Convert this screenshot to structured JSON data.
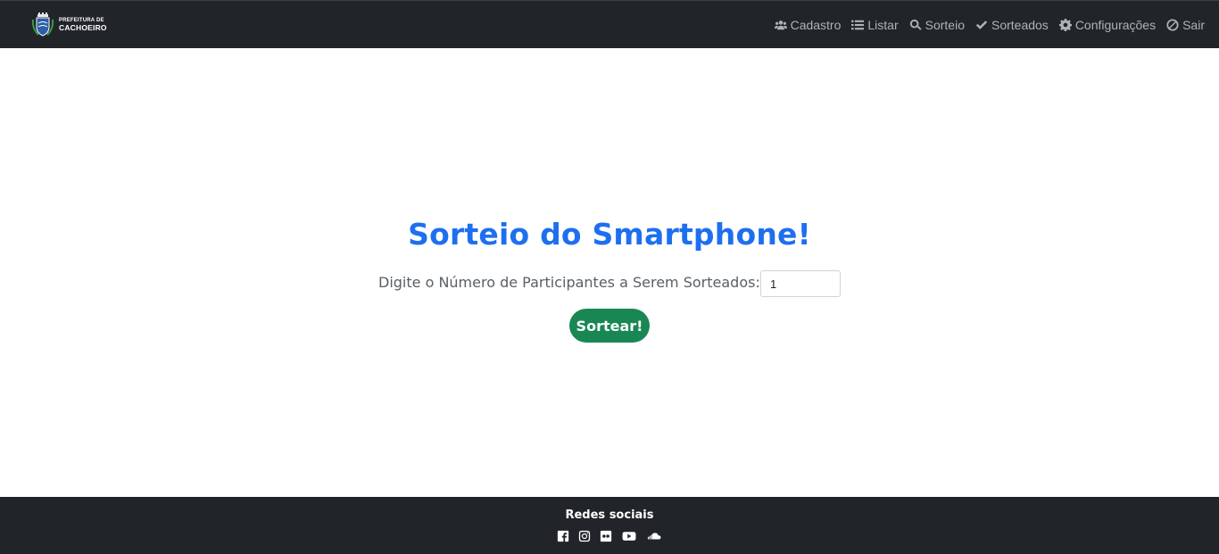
{
  "brand": {
    "logo_name": "prefeitura-cachoeiro-crest",
    "line1": "PREFEITURA DE",
    "line2": "CACHOEIRO"
  },
  "nav": {
    "items": [
      {
        "label": "Cadastro",
        "icon": "users-icon"
      },
      {
        "label": "Listar",
        "icon": "list-icon"
      },
      {
        "label": "Sorteio",
        "icon": "search-icon"
      },
      {
        "label": "Sorteados",
        "icon": "check-icon"
      },
      {
        "label": "Configurações",
        "icon": "gear-icon"
      },
      {
        "label": "Sair",
        "icon": "ban-icon"
      }
    ]
  },
  "main": {
    "title": "Sorteio do Smartphone!",
    "participants_label": "Digite o Número de Participantes a Serem Sorteados:",
    "participants_value": "1",
    "submit_label": "Sortear!"
  },
  "footer": {
    "title": "Redes sociais",
    "social_icons": [
      "facebook-icon",
      "instagram-icon",
      "flickr-icon",
      "youtube-icon",
      "soundcloud-icon"
    ]
  },
  "colors": {
    "navbar_bg": "#212529",
    "nav_text": "#aeb3b8",
    "title": "#1e6ff0",
    "button_bg": "#198754",
    "footer_bg": "#212529"
  }
}
